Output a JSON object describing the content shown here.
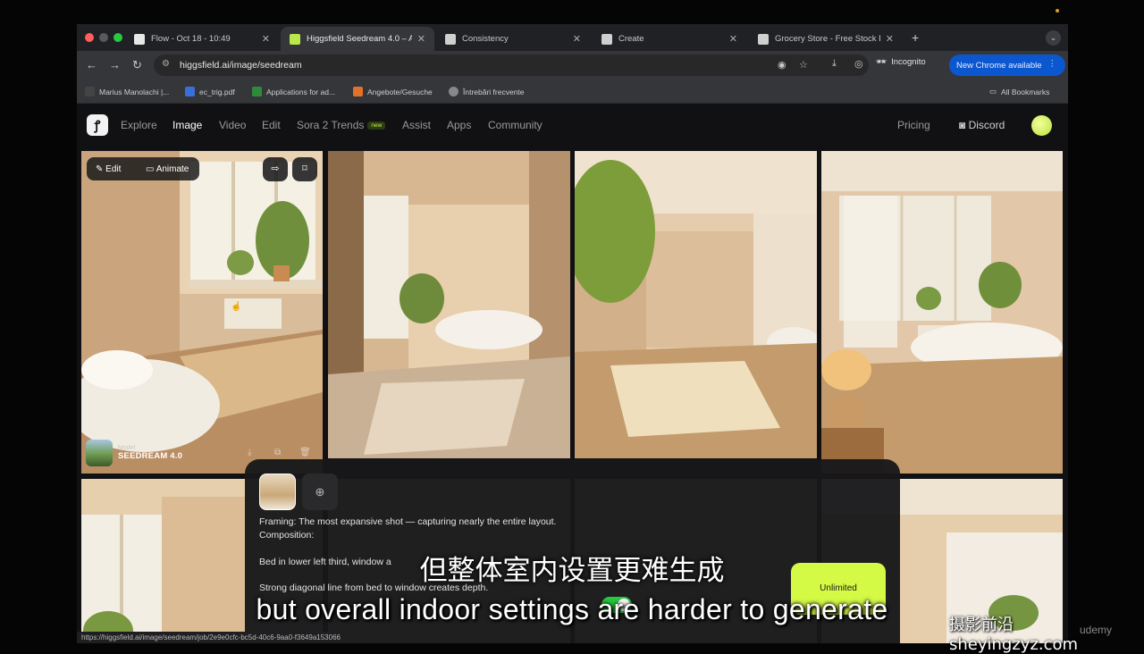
{
  "browser": {
    "tabs": [
      {
        "title": "Flow - Oct 18 - 10:49",
        "favicon_color": "#e8e8e8",
        "active": false
      },
      {
        "title": "Higgsfield Seedream 4.0 – A",
        "favicon_color": "#b9e84a",
        "active": true
      },
      {
        "title": "Consistency",
        "favicon_color": "#cfcfcf",
        "active": false
      },
      {
        "title": "Create",
        "favicon_color": "#cfcfcf",
        "active": false
      },
      {
        "title": "Grocery Store - Free Stock Ph",
        "favicon_color": "#cfcfcf",
        "active": false
      }
    ],
    "url": "higgsfield.ai/image/seedream",
    "incognito_label": "Incognito",
    "new_chrome_label": "New Chrome available",
    "bookmarks": [
      {
        "label": "Marius Manolachi |...",
        "color": "#444"
      },
      {
        "label": "ec_trig.pdf",
        "color": "#3a6fd8"
      },
      {
        "label": "Applications for ad...",
        "color": "#2e8b3a"
      },
      {
        "label": "Angebote/Gesuche",
        "color": "#e0722a"
      },
      {
        "label": "Întrebări frecvente",
        "color": "#888"
      }
    ],
    "all_bookmarks_label": "All Bookmarks",
    "status_url": "https://higgsfield.ai/image/seedream/job/2e9e0cfc-bc5d-40c6-9aa0-f3649a153066"
  },
  "site": {
    "nav": [
      {
        "label": "Explore",
        "active": false
      },
      {
        "label": "Image",
        "active": true
      },
      {
        "label": "Video",
        "active": false
      },
      {
        "label": "Edit",
        "active": false
      },
      {
        "label": "Sora 2 Trends",
        "active": false,
        "badge": "new"
      },
      {
        "label": "Assist",
        "active": false
      },
      {
        "label": "Apps",
        "active": false
      },
      {
        "label": "Community",
        "active": false
      }
    ],
    "pricing_label": "Pricing",
    "discord_label": "Discord",
    "accent_color": "#d4fa45"
  },
  "card": {
    "edit_label": "Edit",
    "animate_label": "Animate",
    "model_caption": "Model",
    "model_name": "SEEDREAM 4.0"
  },
  "prompt": {
    "lines": [
      "Framing: The most expansive shot — capturing nearly the entire layout.",
      "Composition:",
      "Bed in lower left third, window a",
      "Strong diagonal line from bed to window creates depth."
    ],
    "unlimited_label": "Unlimited"
  },
  "subtitles": {
    "chinese": "但整体室内设置更难生成",
    "english": "but overall indoor settings are harder to generate",
    "watermark": "摄影前沿 sheyingzyz.com",
    "udemy": "udemy"
  }
}
